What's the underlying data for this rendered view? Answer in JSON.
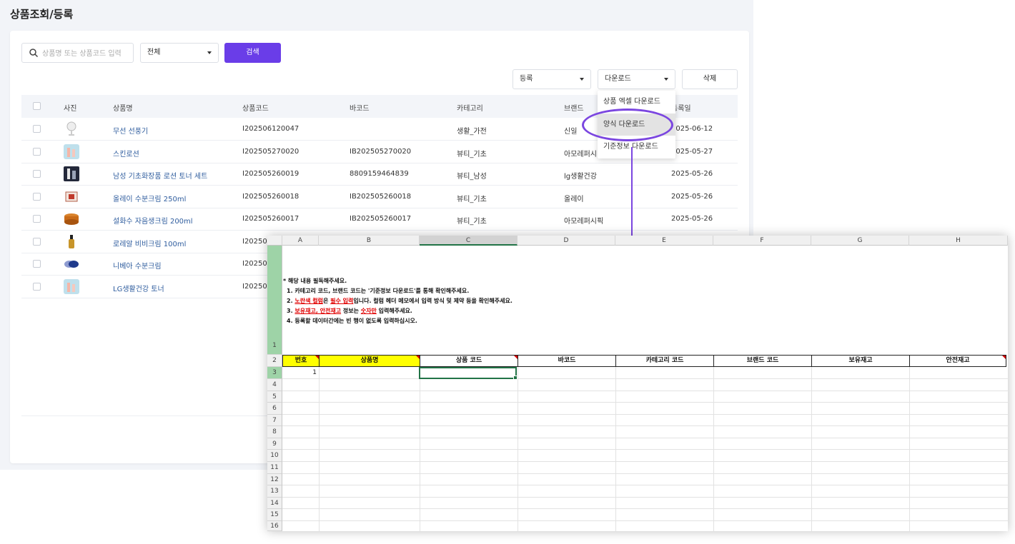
{
  "page_title": "상품조회/등록",
  "search": {
    "placeholder": "상품명 또는 상품코드 입력",
    "category_select": "전체",
    "search_button": "검색"
  },
  "toolbar": {
    "register_select": "등록",
    "download_select": "다운로드",
    "delete_button": "삭제"
  },
  "download_menu": [
    "상품 엑셀 다운로드",
    "양식 다운로드",
    "기준정보 다운로드"
  ],
  "table": {
    "headers": [
      "사진",
      "상품명",
      "상품코드",
      "바코드",
      "카테고리",
      "브랜드",
      "등록일"
    ],
    "rows": [
      {
        "thumb": "fan-icon",
        "name": "무선 선풍기",
        "code": "I202506120047",
        "barcode": "",
        "category": "생활_가전",
        "brand": "신일",
        "date": "2025-06-12"
      },
      {
        "thumb": "lotion-icon",
        "name": "스킨로션",
        "code": "I202505270020",
        "barcode": "IB202505270020",
        "category": "뷰티_기초",
        "brand": "아모레퍼시",
        "date": "2025-05-27"
      },
      {
        "thumb": "mens-set-icon",
        "name": "남성 기초화장품 로션 토너 세트",
        "code": "I202505260019",
        "barcode": "8809159464839",
        "category": "뷰티_남성",
        "brand": "lg생활건강",
        "date": "2025-05-26"
      },
      {
        "thumb": "cream-box-icon",
        "name": "올레이 수분크림 250ml",
        "code": "I202505260018",
        "barcode": "IB202505260018",
        "category": "뷰티_기초",
        "brand": "올레이",
        "date": "2025-05-26"
      },
      {
        "thumb": "cream-jar-icon",
        "name": "설화수 자음생크림 200ml",
        "code": "I202505260017",
        "barcode": "IB202505260017",
        "category": "뷰티_기초",
        "brand": "아모레퍼시픽",
        "date": "2025-05-26"
      },
      {
        "thumb": "bb-bottle-icon",
        "name": "로레알 비비크림 100ml",
        "code": "I20250",
        "barcode": "",
        "category": "",
        "brand": "",
        "date": ""
      },
      {
        "thumb": "nivea-icon",
        "name": "니베아 수분크림",
        "code": "I20250",
        "barcode": "",
        "category": "",
        "brand": "",
        "date": ""
      },
      {
        "thumb": "toner-icon",
        "name": "LG생활건강 토너",
        "code": "I20250",
        "barcode": "",
        "category": "",
        "brand": "",
        "date": ""
      }
    ]
  },
  "excel": {
    "columns": [
      "A",
      "B",
      "C",
      "D",
      "E",
      "F",
      "G",
      "H"
    ],
    "row_numbers": [
      "1",
      "2",
      "3",
      "4",
      "5",
      "6",
      "7",
      "8",
      "9",
      "10",
      "11",
      "12",
      "13",
      "14",
      "15",
      "16"
    ],
    "notes": {
      "line0": "* 해당 내용 필독해주세요.",
      "line1": "1. 카테고리 코드, 브랜드 코드는 '기준정보 다운로드'를 통해 확인해주세요.",
      "line2_a": "2. ",
      "line2_b": "노란색 컬럼",
      "line2_c": "은 ",
      "line2_d": "필수 입력",
      "line2_e": "입니다. 컬럼 헤더 메모에서 입력 방식 및 제약 등을 확인해주세요.",
      "line3_a": "3. ",
      "line3_b": "보유재고, 안전재고",
      "line3_c": " 정보는 ",
      "line3_d": "숫자만",
      "line3_e": " 입력해주세요.",
      "line4": "4. 등록할 데이터간에는 빈 행이 없도록 입력하십시오."
    },
    "header_cells": [
      "번호",
      "상품명",
      "상품 코드",
      "바코드",
      "카테고리 코드",
      "브랜드 코드",
      "보유재고",
      "안전재고"
    ],
    "first_value": "1"
  },
  "colors": {
    "accent": "#6a3de8",
    "callout": "#7b46e0",
    "excel_green": "#217346",
    "required_yellow": "#ffff00"
  }
}
